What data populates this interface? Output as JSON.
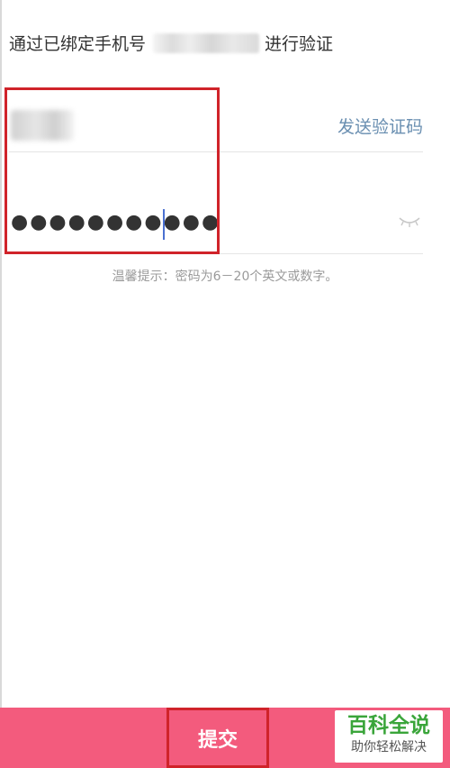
{
  "verify": {
    "prefix": "通过已绑定手机号",
    "suffix": "进行验证"
  },
  "verification_code": {
    "send_label": "发送验证码"
  },
  "password": {
    "value_masked": "●●●●●●●●●●●"
  },
  "hint": {
    "text": "温馨提示：密码为6－20个英文或数字。"
  },
  "footer": {
    "submit_label": "提交"
  },
  "watermark": {
    "main": "百科全说",
    "sub": "助你轻松解决"
  },
  "colors": {
    "accent_link": "#6a8fb1",
    "footer_bar": "#f35b7d",
    "highlight_border": "#d0232a",
    "caret": "#4a70d1",
    "watermark_green": "#3aa53a"
  }
}
